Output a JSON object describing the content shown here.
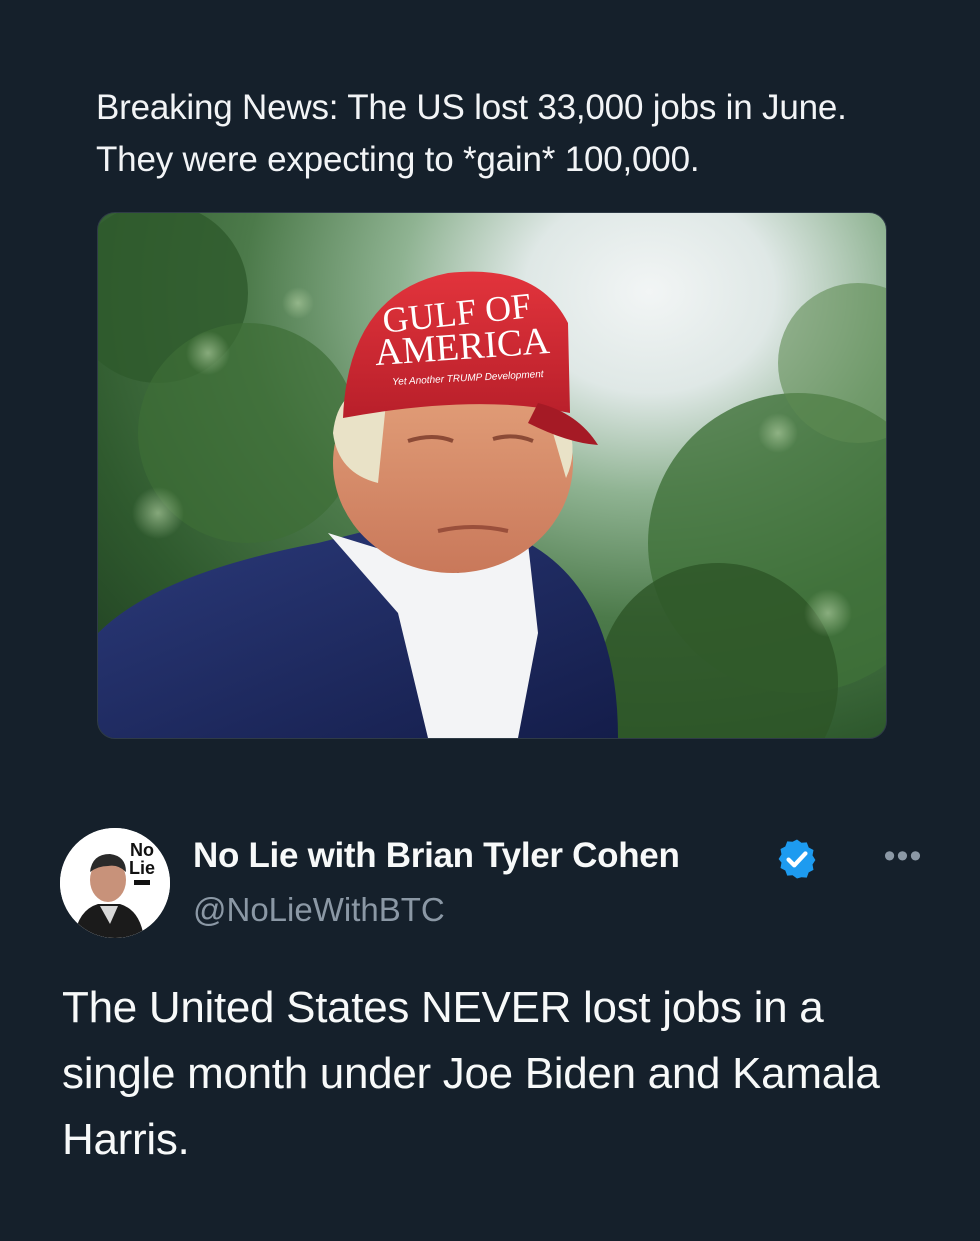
{
  "quoted": {
    "text": "Breaking News: The US lost 33,000 jobs in June. They were expecting to *gain* 100,000."
  },
  "photo": {
    "hat_line1": "GULF OF",
    "hat_line2": "AMERICA",
    "hat_line3": "Yet Another TRUMP Development"
  },
  "author": {
    "name": "No Lie with Brian Tyler Cohen",
    "handle": "@NoLieWithBTC",
    "avatar_logo_line1": "No",
    "avatar_logo_line2": "Lie",
    "verified_icon": "verified-badge-icon",
    "more_icon": "more-options-icon",
    "more_glyph": "•••"
  },
  "tweet": {
    "text": "The United States NEVER lost jobs in a single month under Joe Biden and Kamala Harris."
  },
  "colors": {
    "background": "#15202b",
    "text_primary": "#f7f9f9",
    "text_secondary": "#8b98a5",
    "verified": "#1d9bf0",
    "hat_red": "#d42a33"
  }
}
